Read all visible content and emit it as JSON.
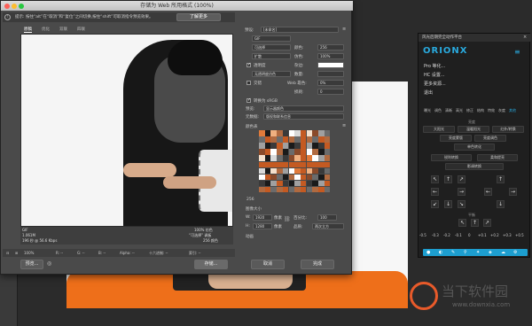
{
  "dialog": {
    "title": "存储为 Web 所用格式 (100%)",
    "hint": "提示: 按住“alt”在“取消”和“复位”之间切换,按住“shift”可取消指令预览效果。",
    "learn_more": "了解更多",
    "tabs": [
      "原稿",
      "优化",
      "双联",
      "四联"
    ],
    "info": {
      "format": "GIF",
      "size": "1.061M",
      "time": "196 秒 @ 56.6 Kbps",
      "percent": "100% 仿色",
      "palette": "“可选择” 调板",
      "colors": "256 颜色"
    },
    "status": {
      "zoom": "100%",
      "r": "R: --",
      "g": "G: --",
      "b": "B: --",
      "alpha": "Alpha: --",
      "hex": "十六进制: --",
      "index": "索引: --"
    },
    "buttons": {
      "preview": "预览...",
      "save": "存储...",
      "cancel": "取消",
      "done": "完成"
    }
  },
  "settings": {
    "preset_label": "预设:",
    "preset_value": "[未命名]",
    "format_value": "GIF",
    "reduction_value": "可选择",
    "dither_algo_value": "扩散",
    "transparency_label": "透明度",
    "matte_label": "杂边:",
    "no_transparency_dither": "无透明度仿色",
    "interlaced_label": "交错",
    "colors_label": "颜色:",
    "colors_value": "256",
    "dither_label": "仿色:",
    "dither_value": "100%",
    "amount_label": "数量:",
    "websnap_label": "Web 靠色:",
    "websnap_value": "0%",
    "lossy_label": "损耗:",
    "lossy_value": "0",
    "convert_srgb": "转换为 sRGB",
    "preview_label": "预览:",
    "preview_value": "显示器颜色",
    "metadata_label": "元数据:",
    "metadata_value": "版权和联系信息",
    "color_table_label": "颜色表",
    "color_count": "256",
    "image_size_label": "图像大小",
    "w_label": "W:",
    "w_value": "1920",
    "h_label": "H:",
    "h_value": "1280",
    "px": "像素",
    "percent_label": "百分比:",
    "percent_value": "100",
    "quality_label": "品质:",
    "quality_value": "两次立方",
    "animation_label": "动画"
  },
  "panel": {
    "title": "风光后期完全动作平台",
    "logo": "ORIONX",
    "menu_1": "Pro 等化...",
    "menu_2": "HC 设置...",
    "menu_3": "更多资源...",
    "menu_4": "退出",
    "tabs": [
      "曝光",
      "调色",
      "清晰",
      "高光",
      "修正",
      "结构",
      "特效",
      "灰度",
      "其他"
    ],
    "section1": "亮度",
    "btn_row1": [
      "大阳光",
      "温暖阳光",
      "红外/转换"
    ],
    "btn_row2": [
      "亮度蒙版",
      "亮度调色"
    ],
    "btn_row3": [
      "单色转化"
    ],
    "btn_row4": [
      "锐利转换",
      "柔和提亮"
    ],
    "btn_row5": [
      "影调转换"
    ],
    "section2": "平衡",
    "numbers": [
      "-0.5",
      "-0.3",
      "-0.2",
      "-0.1",
      "0",
      "+0.1",
      "+0.2",
      "+0.3",
      "+0.5"
    ]
  },
  "watermark": {
    "text": "当下软件园",
    "url": "www.downxia.com"
  },
  "colors": {
    "accent": "#1d9ecf",
    "cushion": "#ee6f1a",
    "panel_bg": "#1f1f1f"
  },
  "icons": [
    "move-icon",
    "marquee-icon",
    "lasso-icon",
    "zoom-icon",
    "eyedropper-icon",
    "hamburger-icon",
    "close-icon"
  ]
}
